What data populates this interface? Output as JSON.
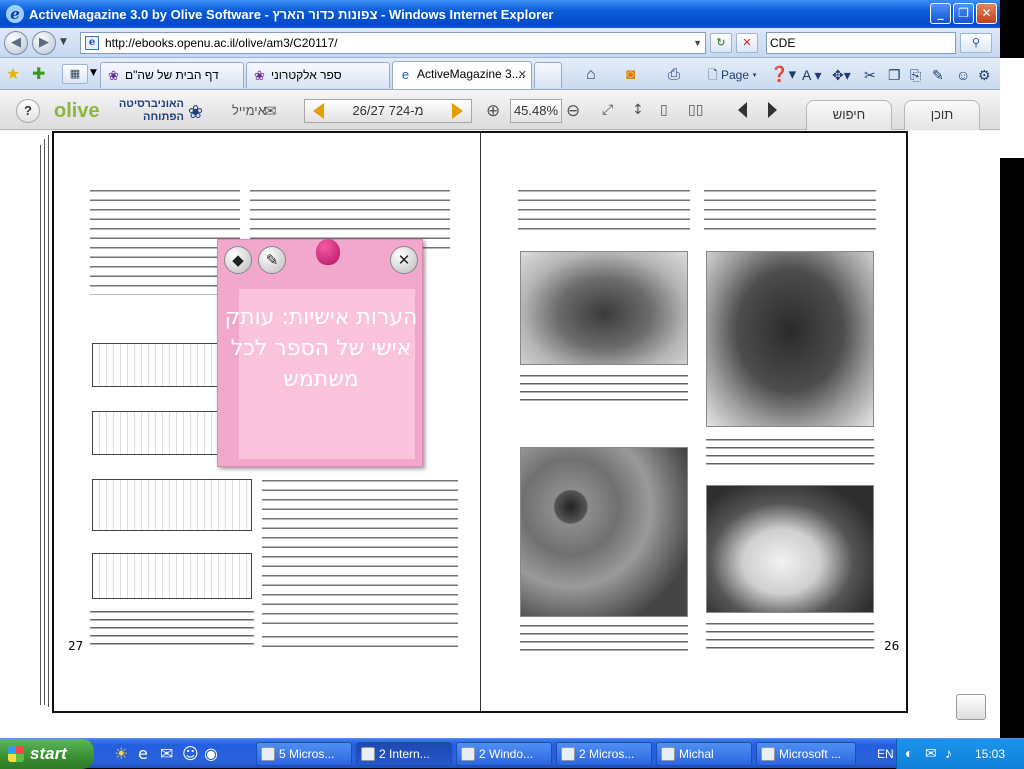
{
  "window": {
    "title": "ActiveMagazine 3.0 by Olive Software - צפונות כדור הארץ - Windows Internet Explorer",
    "buttons": {
      "minimize": "_",
      "maximize": "❐",
      "close": "✕"
    }
  },
  "address_bar": {
    "url": "http://ebooks.openu.ac.il/olive/am3/C20117/",
    "search_value": "CDE",
    "back_glyph": "◀",
    "forward_glyph": "▶",
    "search_glyph": "⚲",
    "refresh_glyph": "↻",
    "stop_glyph": "✕"
  },
  "tabs": {
    "items": [
      {
        "label": "דף הבית של שה\"ם",
        "icon": "olive-icon"
      },
      {
        "label": "ספר אלקטרוני",
        "icon": "olive-icon"
      },
      {
        "label": "ActiveMagazine 3....",
        "icon": "ie-page-icon",
        "close": "✕"
      }
    ],
    "tools": {
      "page_label": "Page",
      "tools_label": "Tools"
    }
  },
  "olive_toolbar": {
    "help_label": "?",
    "brand_logo": "olive",
    "university_name": "האוניברסיטה הפתוחה",
    "email_label": "אימייל",
    "page_indicator": "26/27 מ-724",
    "zoom_value": "45.48%",
    "search_tab": "חיפוש",
    "contents_tab": "תוכן"
  },
  "book": {
    "left_page_number": "27",
    "right_page_number": "26"
  },
  "sticky_note": {
    "text": "הערות אישיות: עותק אישי של הספר לכל משתמש",
    "close_glyph": "✕"
  },
  "taskbar": {
    "start_label": "start",
    "tasks": [
      {
        "label": "5 Micros..."
      },
      {
        "label": "2 Intern..."
      },
      {
        "label": "2 Windo..."
      },
      {
        "label": "2 Micros..."
      },
      {
        "label": "Michal"
      },
      {
        "label": "Microsoft ..."
      }
    ],
    "language": "EN",
    "clock": "15:03"
  }
}
